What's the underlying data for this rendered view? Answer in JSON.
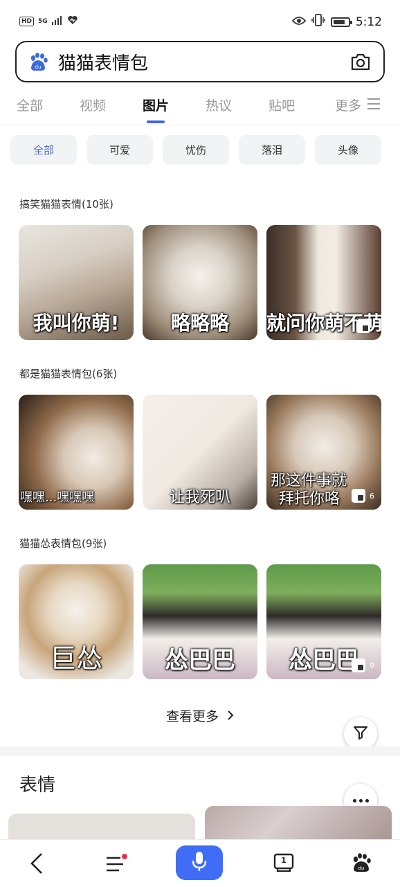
{
  "status_bar": {
    "hd_badge": "HD",
    "network": "5G",
    "time": "5:12"
  },
  "search": {
    "query": "猫猫表情包"
  },
  "tabs": [
    {
      "label": "全部",
      "active": false
    },
    {
      "label": "视频",
      "active": false
    },
    {
      "label": "图片",
      "active": true
    },
    {
      "label": "热议",
      "active": false
    },
    {
      "label": "贴吧",
      "active": false
    },
    {
      "label": "更多",
      "active": false
    }
  ],
  "chips": [
    {
      "label": "全部",
      "active": true
    },
    {
      "label": "可爱",
      "active": false
    },
    {
      "label": "忧伤",
      "active": false
    },
    {
      "label": "落泪",
      "active": false
    },
    {
      "label": "头像",
      "active": false
    }
  ],
  "groups": [
    {
      "title": "搞笑猫猫表情(10张)",
      "images": [
        {
          "caption": "我叫你萌!"
        },
        {
          "caption": "略略略"
        },
        {
          "caption": "就问你萌不萌",
          "count": ""
        }
      ]
    },
    {
      "title": "都是猫猫表情包(6张)",
      "images": [
        {
          "caption": "嘿嘿...嘿嘿嘿"
        },
        {
          "caption": "让我死叭"
        },
        {
          "caption_line1": "那这件事就",
          "caption_line2": "拜托你咯",
          "count": "6"
        }
      ]
    },
    {
      "title": "猫猫怂表情包(9张)",
      "images": [
        {
          "caption": "巨怂"
        },
        {
          "caption": "怂巴巴"
        },
        {
          "caption": "怂巴巴",
          "count": "9"
        }
      ]
    }
  ],
  "more_link": "查看更多",
  "section2_title": "表情",
  "bottom_nav": {
    "tab_count": "1"
  },
  "colors": {
    "accent": "#3d6bd8",
    "mic_button": "#3f6df6",
    "notification_dot": "#e8324a"
  }
}
